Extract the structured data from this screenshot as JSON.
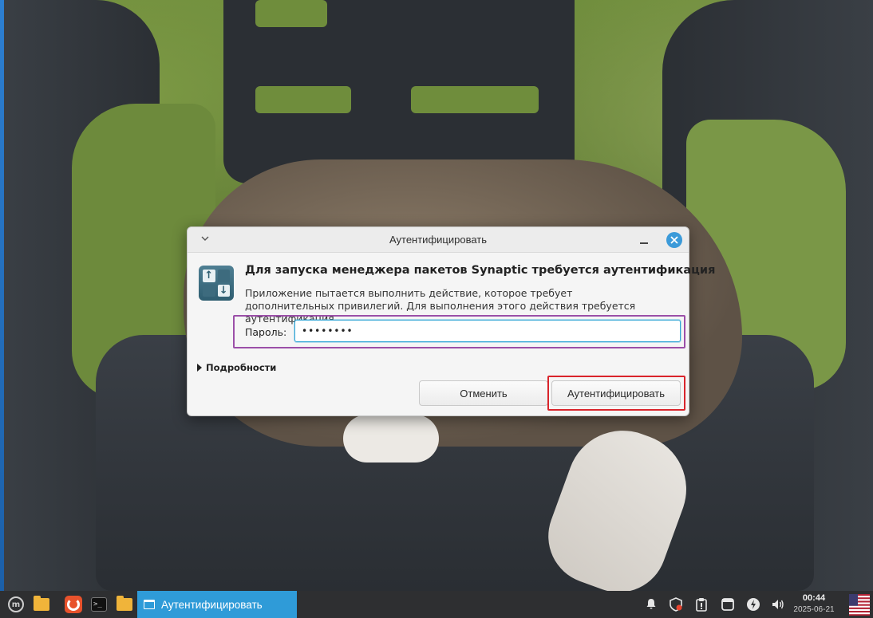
{
  "dialog": {
    "window_title": "Аутентифицировать",
    "heading": "Для запуска менеджера пакетов Synaptic требуется аутентификация",
    "description": "Приложение пытается выполнить действие, которое требует дополнительных привилегий. Для выполнения этого действия требуется аутентификация.",
    "password_label": "Пароль:",
    "password_value": "••••••••",
    "details_label": "Подробности",
    "cancel_label": "Отменить",
    "authenticate_label": "Аутентифицировать",
    "highlight_colors": {
      "password_box": "#9b4fa8",
      "authenticate_box": "#d9242b"
    },
    "accent": "#3b9ad9"
  },
  "taskbar": {
    "active_task_label": "Аутентифицировать",
    "time": "00:44",
    "date": "2025-06-21",
    "accent": "#2f9bd8",
    "icons": [
      "mint-menu-icon",
      "folder-icon",
      "firefox-icon",
      "terminal-icon",
      "files-icon",
      "bell-icon",
      "shield-update-icon",
      "clipboard-icon",
      "window-icon",
      "power-icon",
      "volume-icon",
      "us-flag-icon"
    ]
  }
}
